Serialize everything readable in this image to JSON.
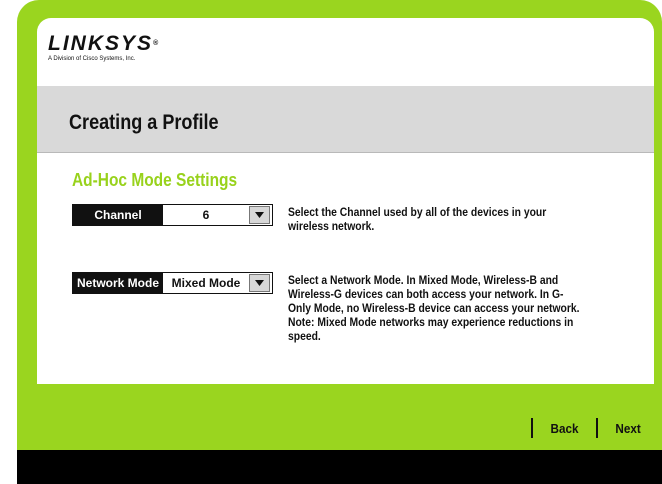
{
  "logo": {
    "wordmark": "LINKSYS",
    "registered": "®",
    "tagline": "A Division of Cisco Systems, Inc."
  },
  "page_title": "Creating a Profile",
  "section_title": "Ad-Hoc Mode Settings",
  "channel": {
    "label": "Channel",
    "value": "6",
    "description": "Select the Channel used by all of the devices in your wireless network."
  },
  "network_mode": {
    "label": "Network Mode",
    "value": "Mixed Mode",
    "desc_part1": "Select a Network Mode. In ",
    "desc_bold1": "Mixed Mode",
    "desc_part2": ", Wireless-B and Wireless-G devices can both access your network. In ",
    "desc_bold2": "G-Only Mode",
    "desc_part3": ", no Wireless-B device can access your network. Note: Mixed Mode networks may experience reductions in speed."
  },
  "nav": {
    "back_label": "Back",
    "next_label": "Next"
  },
  "colors": {
    "accent_green": "#9ad51f",
    "section_title": "#98d21c",
    "title_band": "#d9d9d9"
  },
  "icons": {
    "dropdown": "triangle-down-icon"
  }
}
